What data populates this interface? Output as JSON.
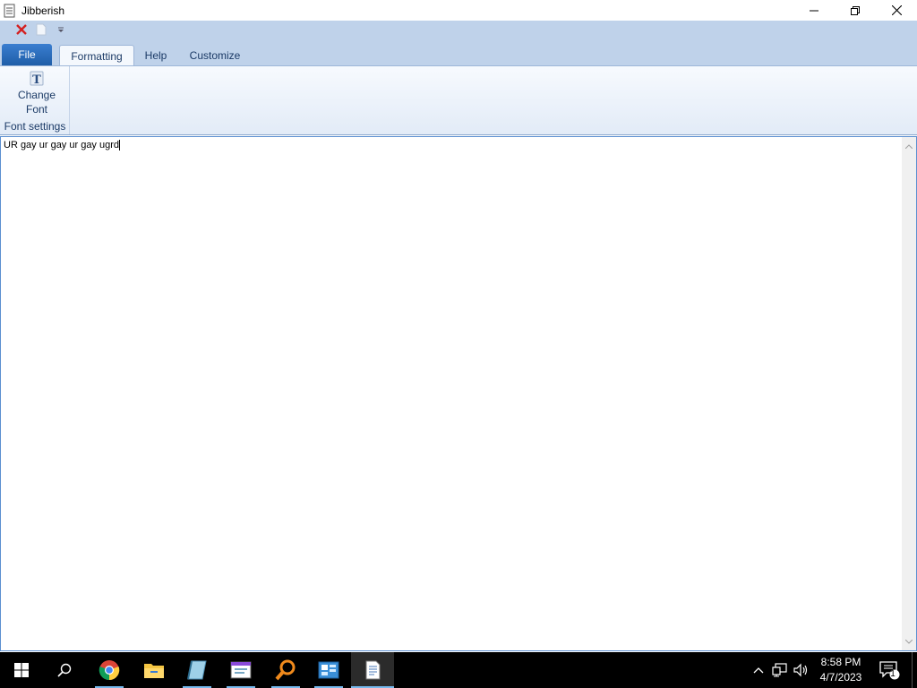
{
  "window": {
    "title": "Jibberish",
    "icon": "notepad-document-icon",
    "controls": [
      "minimize-icon",
      "restore-icon",
      "close-icon"
    ]
  },
  "quick_access": [
    "close-document-icon",
    "new-document-icon",
    "customize-toolbar-chevron-icon"
  ],
  "tabs": {
    "file": "File",
    "items": [
      {
        "label": "Formatting",
        "active": true
      },
      {
        "label": "Help",
        "active": false
      },
      {
        "label": "Customize",
        "active": false
      }
    ]
  },
  "ribbon": {
    "groups": [
      {
        "label": "Font settings",
        "buttons": [
          {
            "label_line1": "Change",
            "label_line2": "Font",
            "icon": "font-icon"
          }
        ]
      }
    ]
  },
  "editor": {
    "text": "UR gay ur gay ur gay ugrd"
  },
  "taskbar": {
    "items": [
      "start-icon",
      "search-icon",
      "chrome-icon",
      "file-explorer-icon",
      "notebook-app-icon",
      "window-app-icon",
      "magnifier-search-app-icon",
      "control-panel-icon",
      "jibberish-app-icon"
    ],
    "tray_icons": [
      "show-hidden-icons-chevron",
      "network-icon",
      "volume-icon"
    ],
    "time": "8:58 PM",
    "date": "4/7/2023",
    "notifications_count": "1"
  },
  "colors": {
    "ribbon_blue": "#bfd2ea",
    "file_tab": "#2b6cbf",
    "taskbar": "#000000",
    "active_indicator": "#76b9ed"
  }
}
